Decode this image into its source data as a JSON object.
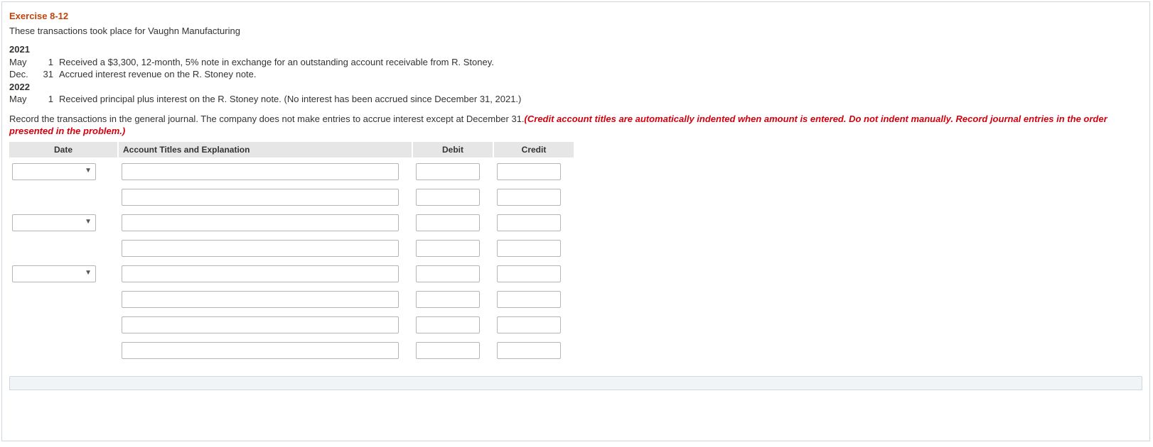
{
  "heading": "Exercise 8-12",
  "intro": "These transactions took place for Vaughn Manufacturing",
  "transactions": {
    "year1": "2021",
    "rows1": [
      {
        "month": "May",
        "day": "1",
        "desc": "Received a $3,300, 12-month, 5% note in exchange for an outstanding account receivable from R. Stoney."
      },
      {
        "month": "Dec.",
        "day": "31",
        "desc": "Accrued interest revenue on the R. Stoney note."
      }
    ],
    "year2": "2022",
    "rows2": [
      {
        "month": "May",
        "day": "1",
        "desc": "Received principal plus interest on the R. Stoney note. (No interest has been accrued since December 31, 2021.)"
      }
    ]
  },
  "prompt_plain": "Record the transactions in the general journal. The company does not make entries to accrue interest except at December 31.",
  "prompt_red": "(Credit account titles are automatically indented when amount is entered. Do not indent manually. Record journal entries in the order presented in the problem.)",
  "journal": {
    "headers": {
      "date": "Date",
      "acct": "Account Titles and Explanation",
      "debit": "Debit",
      "credit": "Credit"
    },
    "rows": [
      {
        "has_date": true
      },
      {
        "has_date": false
      },
      {
        "has_date": true
      },
      {
        "has_date": false
      },
      {
        "has_date": true
      },
      {
        "has_date": false
      },
      {
        "has_date": false
      },
      {
        "has_date": false
      }
    ]
  }
}
